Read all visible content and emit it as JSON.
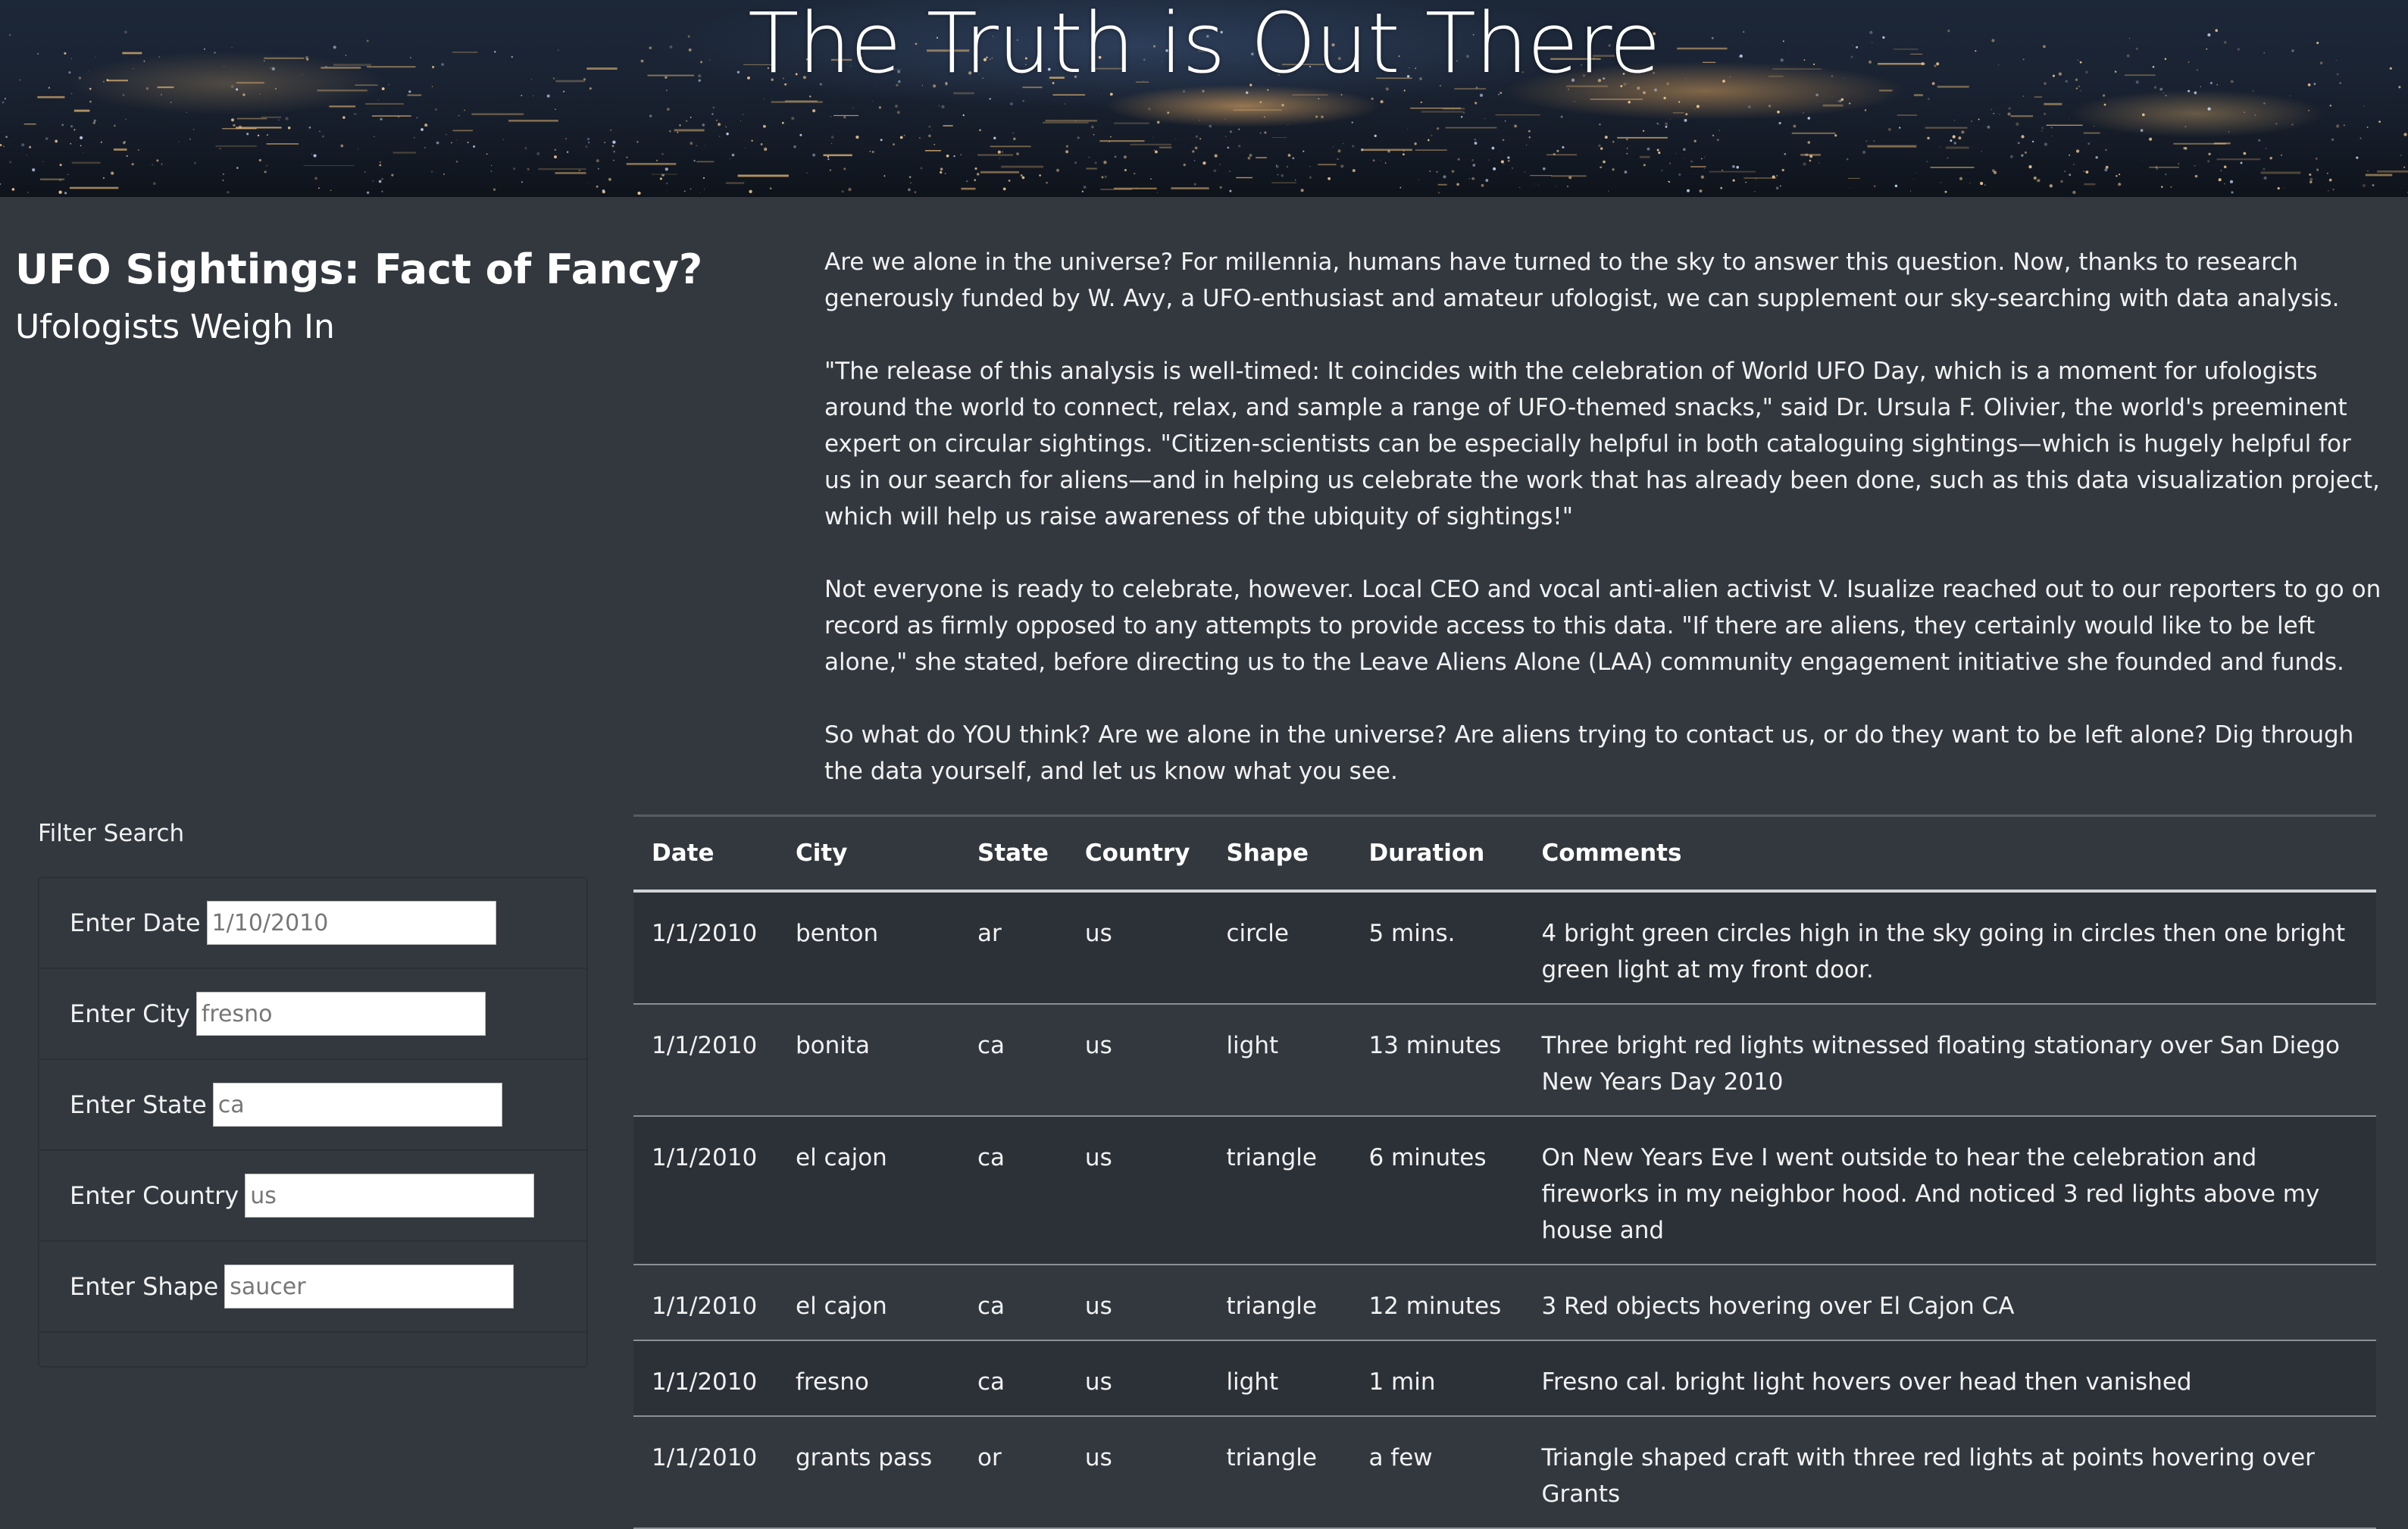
{
  "hero": {
    "title": "The Truth is Out There"
  },
  "headline": {
    "strong": "UFO Sightings: Fact of Fancy?",
    "sub": "Ufologists Weigh In"
  },
  "article": {
    "paragraphs": [
      "Are we alone in the universe? For millennia, humans have turned to the sky to answer this question. Now, thanks to research generously funded by W. Avy, a UFO-enthusiast and amateur ufologist, we can supplement our sky-searching with data analysis.",
      "\"The release of this analysis is well-timed: It coincides with the celebration of World UFO Day, which is a moment for ufologists around the world to connect, relax, and sample a range of UFO-themed snacks,\" said Dr. Ursula F. Olivier, the world's preeminent expert on circular sightings. \"Citizen-scientists can be especially helpful in both cataloguing sightings—which is hugely helpful for us in our search for aliens—and in helping us celebrate the work that has already been done, such as this data visualization project, which will help us raise awareness of the ubiquity of sightings!\"",
      "Not everyone is ready to celebrate, however. Local CEO and vocal anti-alien activist V. Isualize reached out to our reporters to go on record as firmly opposed to any attempts to provide access to this data. \"If there are aliens, they certainly would like to be left alone,\" she stated, before directing us to the Leave Aliens Alone (LAA) community engagement initiative she founded and funds.",
      "So what do YOU think? Are we alone in the universe? Are aliens trying to contact us, or do they want to be left alone? Dig through the data yourself, and let us know what you see."
    ]
  },
  "filters": {
    "title": "Filter Search",
    "items": [
      {
        "label": "Enter Date",
        "placeholder": "1/10/2010"
      },
      {
        "label": "Enter City",
        "placeholder": "fresno"
      },
      {
        "label": "Enter State",
        "placeholder": "ca"
      },
      {
        "label": "Enter Country",
        "placeholder": "us"
      },
      {
        "label": "Enter Shape",
        "placeholder": "saucer"
      }
    ]
  },
  "table": {
    "headers": [
      "Date",
      "City",
      "State",
      "Country",
      "Shape",
      "Duration",
      "Comments"
    ],
    "rows": [
      [
        "1/1/2010",
        "benton",
        "ar",
        "us",
        "circle",
        "5 mins.",
        "4 bright green circles high in the sky going in circles then one bright green light at my front door."
      ],
      [
        "1/1/2010",
        "bonita",
        "ca",
        "us",
        "light",
        "13 minutes",
        "Three bright red lights witnessed floating stationary over San Diego New Years Day 2010"
      ],
      [
        "1/1/2010",
        "el cajon",
        "ca",
        "us",
        "triangle",
        "6 minutes",
        "On New Years Eve I went outside to hear the celebration and fireworks in my neighbor hood. And noticed 3 red lights above my house and"
      ],
      [
        "1/1/2010",
        "el cajon",
        "ca",
        "us",
        "triangle",
        "12 minutes",
        "3 Red objects hovering over El Cajon CA"
      ],
      [
        "1/1/2010",
        "fresno",
        "ca",
        "us",
        "light",
        "1 min",
        "Fresno cal. bright light hovers over head then vanished"
      ],
      [
        "1/1/2010",
        "grants pass",
        "or",
        "us",
        "triangle",
        "a few",
        "Triangle shaped craft with three red lights at points hovering over Grants"
      ]
    ]
  }
}
